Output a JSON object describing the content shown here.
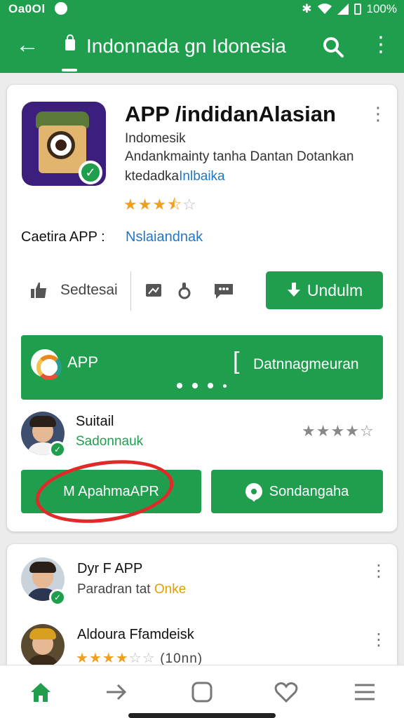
{
  "status_bar": {
    "time": "Oa0Ol",
    "battery": "100%"
  },
  "app_bar": {
    "title": "Indonnada gn Idonesia"
  },
  "app": {
    "title": "APP /indidanAlasian",
    "developer": "Indomesik",
    "description_line1": "Andankmainty tanha Dantan Dotankan",
    "description_line2_prefix": "ktedadka",
    "description_line2_link": "Inlbaika",
    "rating": 3.5,
    "rating_display": "★★★☆☆"
  },
  "category": {
    "label": "Caetira APP :",
    "value": "Nslaiandnak"
  },
  "actions": {
    "share_label": "Sedtesai",
    "install_label": "Undulm"
  },
  "banner": {
    "app_label": "APP",
    "cta_label": "Datnnagmeuran"
  },
  "review1": {
    "name": "Suitail",
    "subtitle": "Sadonnauk",
    "rating": 4
  },
  "buttons": {
    "left_label": "M ApahmaAPR",
    "right_label": "Sondangaha"
  },
  "review2": {
    "name": "Dyr F APP",
    "subtitle_prefix": "Paradran tat ",
    "subtitle_highlight": "Onke"
  },
  "review3": {
    "name": "Aldoura Ffamdeisk",
    "rating": 4,
    "count": "(10nn)"
  },
  "bottom_nav": [
    {
      "name": "home-icon"
    },
    {
      "name": "arrow-right-icon"
    },
    {
      "name": "square-icon"
    },
    {
      "name": "heart-icon"
    },
    {
      "name": "menu-icon"
    }
  ],
  "colors": {
    "primary": "#1f9e4e",
    "link": "#1f77c6",
    "star": "#f0a020",
    "annotation": "#e02a2a"
  }
}
